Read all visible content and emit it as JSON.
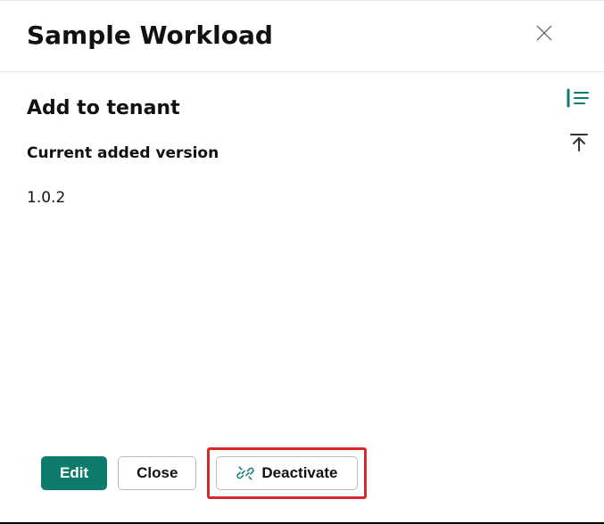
{
  "header": {
    "title": "Sample Workload"
  },
  "section": {
    "title": "Add to tenant",
    "version_label": "Current added version",
    "version_value": "1.0.2"
  },
  "footer": {
    "edit": "Edit",
    "close": "Close",
    "deactivate": "Deactivate"
  }
}
